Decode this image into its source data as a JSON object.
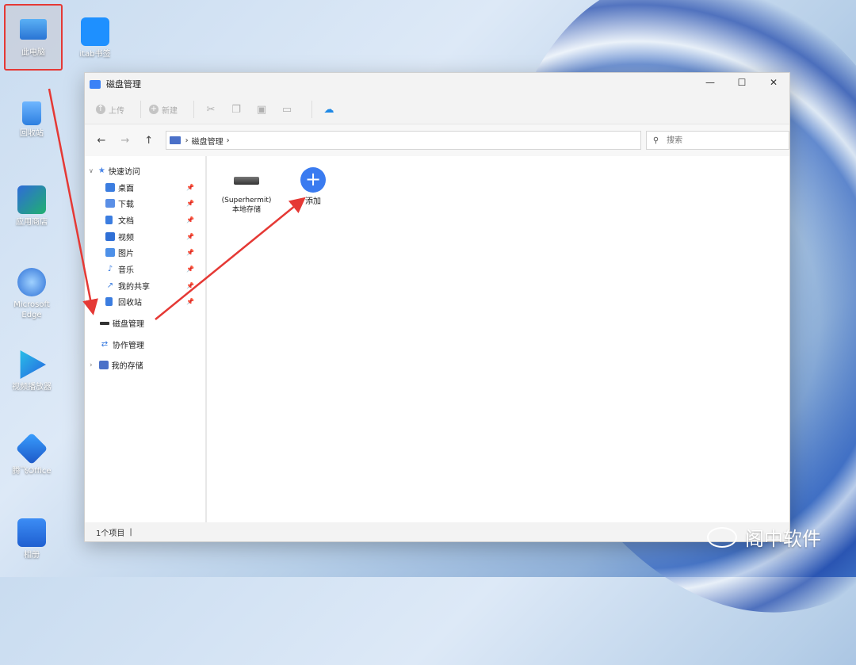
{
  "desktop": {
    "icons": [
      {
        "label": "此电脑"
      },
      {
        "label": "itab书签"
      },
      {
        "label": "回收站"
      },
      {
        "label": "应用商店"
      },
      {
        "label": "Microsoft Edge"
      },
      {
        "label": "视频播放器"
      },
      {
        "label": "腾飞Office"
      },
      {
        "label": "相册"
      }
    ]
  },
  "window": {
    "title": "磁盘管理",
    "controls": {
      "minimize": "—",
      "maximize": "☐",
      "close": "✕"
    }
  },
  "toolbar": {
    "upload": "上传",
    "new": "新建"
  },
  "nav": {
    "back": "←",
    "forward": "→",
    "up": "↑",
    "breadcrumb": "磁盘管理",
    "search_placeholder": "搜索"
  },
  "sidebar": {
    "quick_access": "快速访问",
    "items": [
      "桌面",
      "下载",
      "文档",
      "视频",
      "图片",
      "音乐",
      "我的共享",
      "回收站"
    ],
    "disk_manage": "磁盘管理",
    "collab_manage": "协作管理",
    "my_storage": "我的存储"
  },
  "content": {
    "drive_line1": "(Superhermit)",
    "drive_line2": "本地存储",
    "add_label": "添加"
  },
  "status": {
    "count": "1个项目"
  },
  "watermark": "阁中软件",
  "colors": {
    "accent": "#3a7bf0",
    "annotation": "#e53935"
  }
}
